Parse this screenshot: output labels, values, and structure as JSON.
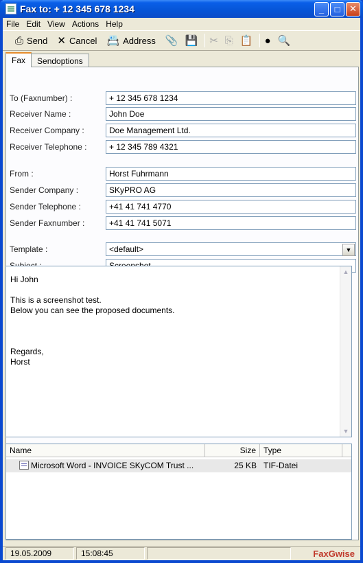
{
  "window": {
    "title": "Fax to: + 12 345 678 1234"
  },
  "menu": [
    "File",
    "Edit",
    "View",
    "Actions",
    "Help"
  ],
  "toolbar": {
    "send_label": "Send",
    "cancel_label": "Cancel",
    "address_label": "Address"
  },
  "tabs": [
    "Fax",
    "Sendoptions"
  ],
  "form": {
    "to_label": "To (Faxnumber) :",
    "to_value": "+ 12 345 678 1234",
    "receiver_name_label": "Receiver Name :",
    "receiver_name_value": "John Doe",
    "receiver_company_label": "Receiver Company :",
    "receiver_company_value": "Doe Management Ltd.",
    "receiver_phone_label": "Receiver Telephone :",
    "receiver_phone_value": "+ 12 345 789 4321",
    "from_label": "From :",
    "from_value": "Horst Fuhrmann",
    "sender_company_label": "Sender Company :",
    "sender_company_value": "SKyPRO AG",
    "sender_phone_label": "Sender Telephone :",
    "sender_phone_value": "+41 41 741 4770",
    "sender_fax_label": "Sender Faxnumber :",
    "sender_fax_value": "+41 41 741 5071",
    "template_label": "Template :",
    "template_value": "<default>",
    "subject_label": "Subject :",
    "subject_value": "Screenshot"
  },
  "message": {
    "lines": [
      "Hi John",
      "",
      "This is a screenshot test.",
      "Below you can see the proposed documents.",
      "",
      "",
      "",
      "Regards,",
      "Horst"
    ]
  },
  "attachments": {
    "headers": {
      "name": "Name",
      "size": "Size",
      "type": "Type"
    },
    "rows": [
      {
        "name": "Microsoft Word - INVOICE SKyCOM Trust ...",
        "size": "25 KB",
        "type": "TIF-Datei"
      }
    ]
  },
  "status": {
    "date": "19.05.2009",
    "time": "15:08:45",
    "brand": "FaxGwise"
  }
}
